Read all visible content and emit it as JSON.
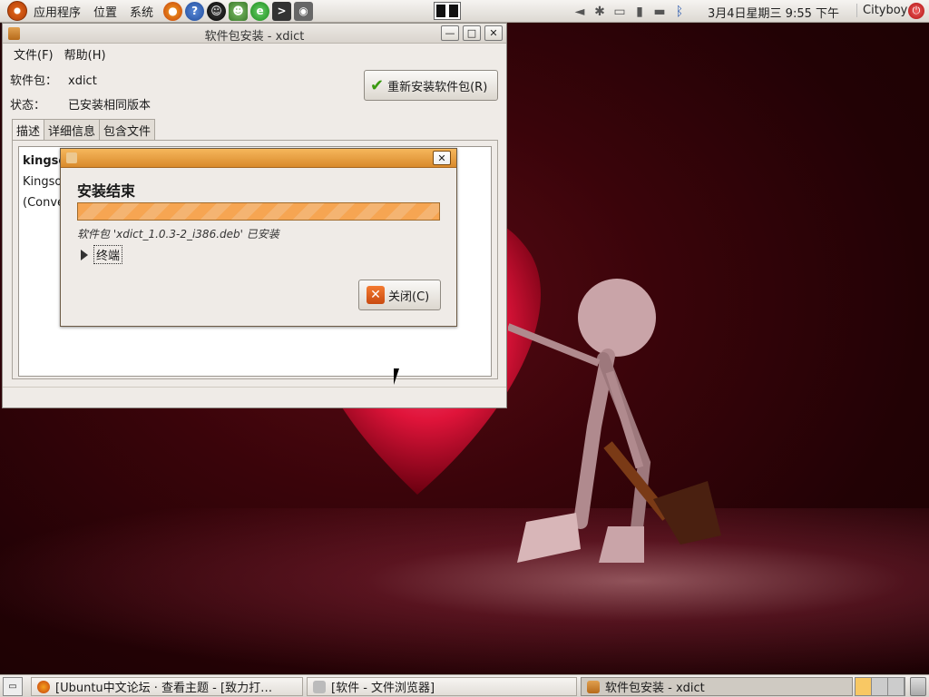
{
  "top_panel": {
    "menus": [
      "应用程序",
      "位置",
      "系统"
    ],
    "launchers": [
      "firefox-icon",
      "help-icon",
      "qq-icon",
      "messenger-icon",
      "ie-icon",
      "terminal-icon",
      "camera-icon"
    ],
    "clock": "3月4日星期三   9:55 下午",
    "user": "Cityboy"
  },
  "window": {
    "title": "软件包安装 - xdict",
    "menu": [
      "文件(F)",
      "帮助(H)"
    ],
    "package_label": "软件包：",
    "package_value": "xdict",
    "status_label": "状态：",
    "status_value": "已安装相同版本",
    "reinstall_label": "重新安装软件包(R)",
    "tabs": [
      "描述",
      "详细信息",
      "包含文件"
    ],
    "desc_title": "kingsof",
    "desc_line1": "Kingsof",
    "desc_line2": "(Conve"
  },
  "dialog": {
    "heading": "安装结束",
    "progress": 1.0,
    "message": "软件包 'xdict_1.0.3-2_i386.deb' 已安装",
    "expander": "终端",
    "close_label": "关闭(C)"
  },
  "taskbar": {
    "tasks": [
      "[Ubuntu中文论坛 · 查看主题 - [致力打…",
      "[软件 - 文件浏览器]",
      "软件包安装 - xdict"
    ]
  },
  "colors": {
    "accent": "#e8912e",
    "desktop": "#3a040a"
  }
}
